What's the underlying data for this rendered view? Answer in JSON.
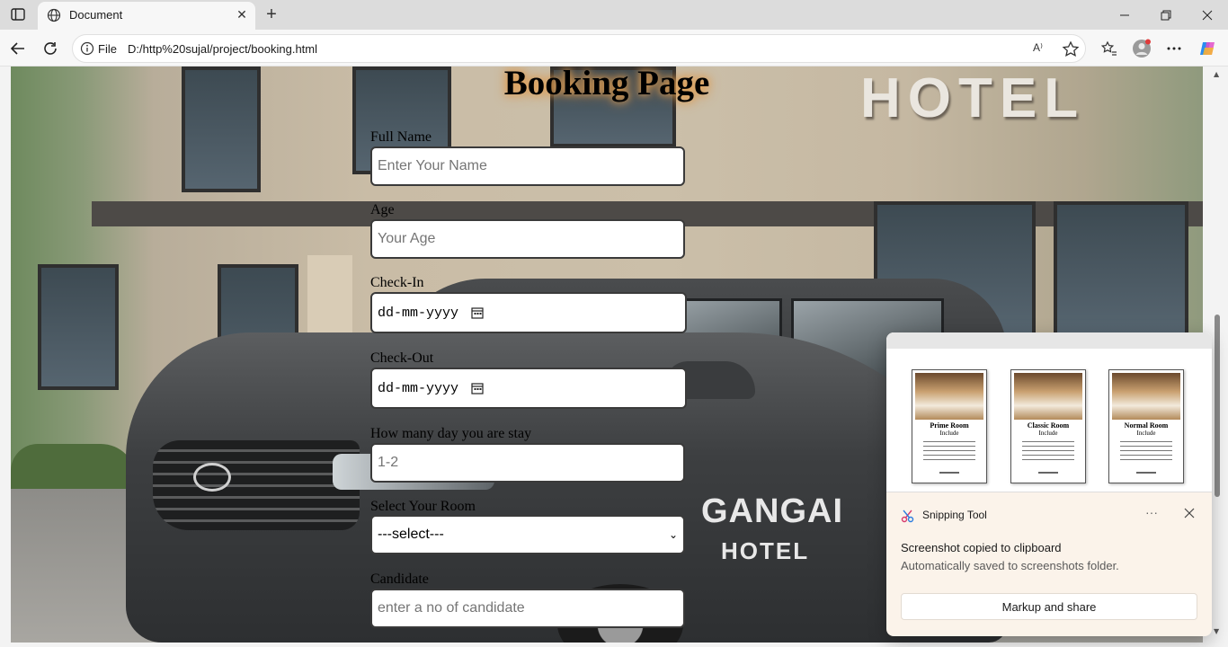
{
  "browser": {
    "tab_title": "Document",
    "address_scheme": "File",
    "address_url": "D:/http%20sujal/project/booking.html",
    "readaloud_label": "A⁾"
  },
  "page": {
    "title": "Booking Page",
    "background_sign": "HOTEL",
    "car_text_line1": "GANGAI",
    "car_text_line2": "HOTEL",
    "fields": {
      "full_name": {
        "label": "Full Name",
        "placeholder": "Enter Your Name"
      },
      "age": {
        "label": "Age",
        "placeholder": "Your Age"
      },
      "check_in": {
        "label": "Check-In",
        "value": "dd-mm-yyyy"
      },
      "check_out": {
        "label": "Check-Out",
        "value": "dd-mm-yyyy"
      },
      "days": {
        "label": "How many day you are stay",
        "placeholder": "1-2"
      },
      "room": {
        "label": "Select Your Room",
        "selected": "---select---"
      },
      "candidate": {
        "label": "Candidate",
        "placeholder": "enter a no of candidate"
      }
    }
  },
  "snipping_toast": {
    "app_name": "Snipping Tool",
    "more_label": "···",
    "message_title": "Screenshot copied to clipboard",
    "message_body": "Automatically saved to screenshots folder.",
    "button_label": "Markup and share",
    "thumbnail_cards": [
      {
        "name": "Prime Room",
        "sub": "Include"
      },
      {
        "name": "Classic Room",
        "sub": "Include"
      },
      {
        "name": "Normal Room",
        "sub": "Include"
      }
    ]
  },
  "colors": {
    "title_glow": "#e3a257",
    "toast_bg": "#fbf3ea",
    "accent_copilot": "#4f6bed"
  }
}
